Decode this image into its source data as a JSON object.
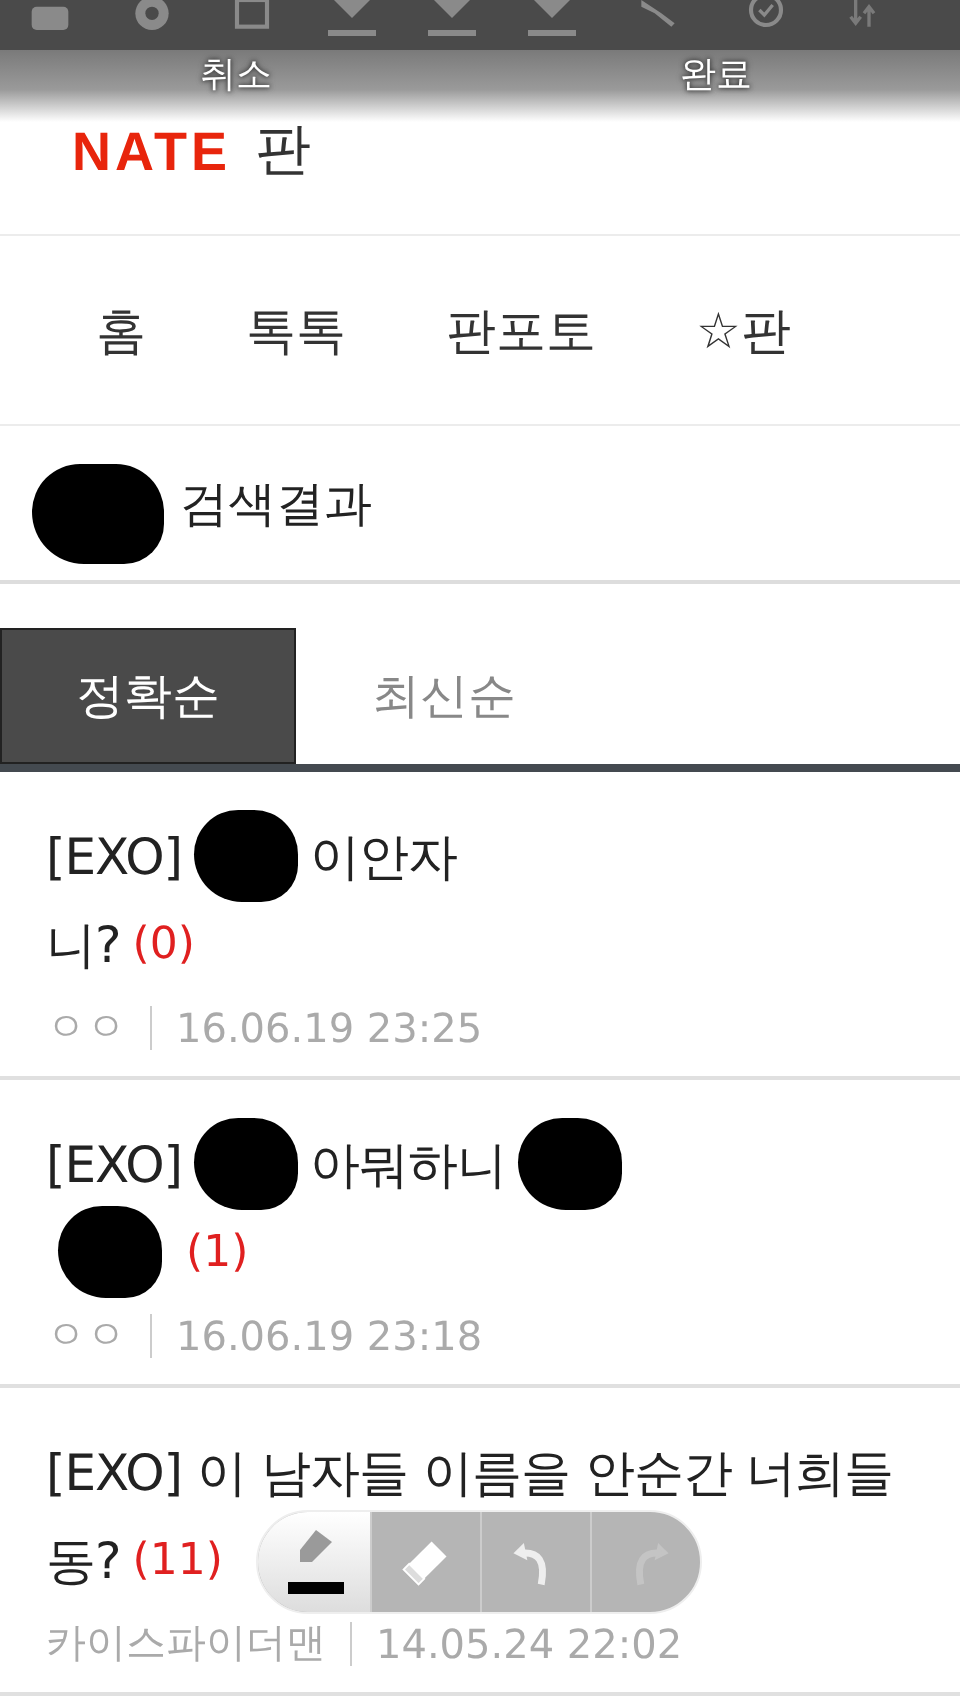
{
  "overlay": {
    "cancel": "취소",
    "done": "완료"
  },
  "logo": {
    "brand": "NATE",
    "service": "판"
  },
  "nav": [
    {
      "label": "홈"
    },
    {
      "label": "톡톡"
    },
    {
      "label": "판포토"
    },
    {
      "label": "☆판"
    }
  ],
  "search_result": {
    "label": "검색결과"
  },
  "sort_tabs": [
    {
      "label": "정확순",
      "selected": true
    },
    {
      "label": "최신순",
      "selected": false
    }
  ],
  "posts": [
    {
      "lines": [
        [
          {
            "kind": "text",
            "text": "[EXO]"
          },
          {
            "kind": "redaction"
          },
          {
            "kind": "text",
            "text": "이안자"
          }
        ],
        [
          {
            "kind": "text",
            "text": "니?"
          },
          {
            "kind": "comments",
            "text": "(0)"
          }
        ]
      ],
      "author": "ㅇㅇ",
      "date": "16.06.19 23:25"
    },
    {
      "lines": [
        [
          {
            "kind": "text",
            "text": "[EXO]"
          },
          {
            "kind": "redaction"
          },
          {
            "kind": "text",
            "text": "아뭐하니"
          },
          {
            "kind": "redaction"
          }
        ],
        [
          {
            "kind": "redaction"
          },
          {
            "kind": "comments",
            "text": "(1)"
          }
        ]
      ],
      "author": "ㅇㅇ",
      "date": "16.06.19 23:18"
    },
    {
      "lines": [
        [
          {
            "kind": "text",
            "text": "[EXO] 이 남자들 이름을 안순간 너희들"
          }
        ],
        [
          {
            "kind": "text",
            "text": "동?"
          },
          {
            "kind": "comments",
            "text": "(11)"
          }
        ]
      ],
      "author": "카이스파이더맨",
      "date": "14.05.24 22:02"
    }
  ]
}
